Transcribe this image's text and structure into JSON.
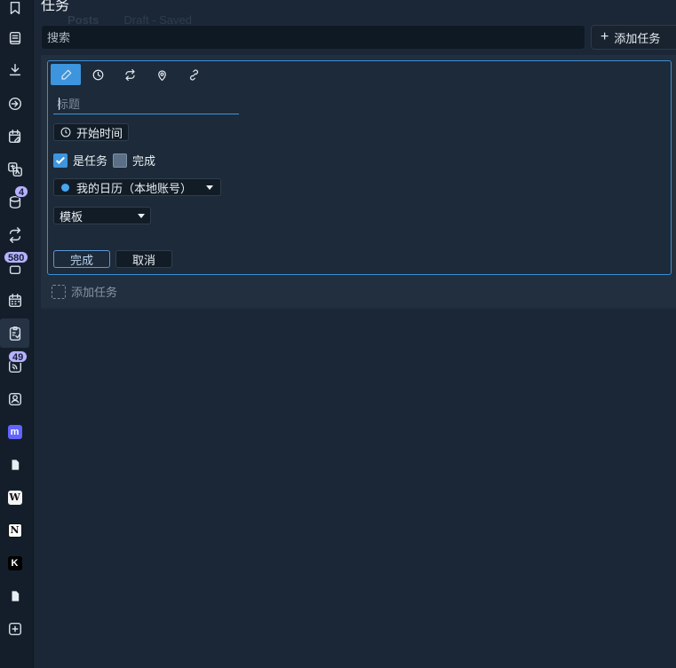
{
  "page": {
    "title": "任务"
  },
  "ghost": {
    "posts": "Posts",
    "draft": "Draft - Saved"
  },
  "search": {
    "placeholder": "搜索",
    "value": ""
  },
  "toolbar": {
    "add_task_label": "添加任务",
    "add_task_icon": "plus-icon"
  },
  "sidebar": {
    "items": [
      {
        "name": "bookmark-icon"
      },
      {
        "name": "notebook-icon"
      },
      {
        "name": "download-icon"
      },
      {
        "name": "sync-circle-icon"
      },
      {
        "name": "calendar-edit-icon"
      },
      {
        "name": "translate-icon"
      },
      {
        "name": "database-icon",
        "badge": "4"
      },
      {
        "name": "repeat-icon"
      },
      {
        "name": "archive-icon",
        "badge": "580"
      },
      {
        "name": "calendar-icon"
      },
      {
        "name": "tasks-icon",
        "active": true
      },
      {
        "name": "rss-icon",
        "badge": "49"
      },
      {
        "name": "contact-icon"
      },
      {
        "name": "mastodon-icon"
      },
      {
        "name": "document-icon"
      },
      {
        "name": "wikipedia-icon",
        "glyph": "W"
      },
      {
        "name": "notion-icon",
        "glyph": "N"
      },
      {
        "name": "k-app-icon",
        "glyph": "K"
      },
      {
        "name": "document-icon-2"
      },
      {
        "name": "add-app-icon"
      }
    ]
  },
  "editor": {
    "tools": [
      {
        "name": "edit-icon",
        "active": true
      },
      {
        "name": "clock-icon"
      },
      {
        "name": "repeat-icon"
      },
      {
        "name": "location-icon"
      },
      {
        "name": "link-icon"
      }
    ],
    "title_placeholder": "标题",
    "start_time_label": "开始时间",
    "is_task_label": "是任务",
    "is_task_checked": true,
    "completed_label": "完成",
    "completed_checked": false,
    "calendar_select": "我的日历（本地账号）",
    "calendar_color": "#47a6f0",
    "template_select": "模板",
    "done_button": "完成",
    "cancel_button": "取消"
  },
  "new_task": {
    "label": "添加任务"
  },
  "colors": {
    "accent": "#3c95dd",
    "background": "#1b2736",
    "sidebar": "#141e2a"
  }
}
